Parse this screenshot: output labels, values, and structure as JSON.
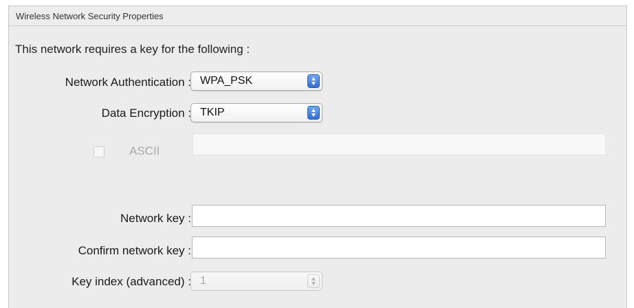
{
  "panel": {
    "title": "Wireless Network Security Properties"
  },
  "intro_text": "This network requires a key for the following :",
  "network_authentication": {
    "label": "Network Authentication :",
    "value": "WPA_PSK"
  },
  "data_encryption": {
    "label": "Data Encryption :",
    "value": "TKIP"
  },
  "ascii": {
    "label": "ASCII",
    "checked": false,
    "enabled": false,
    "field_value": ""
  },
  "network_key": {
    "label": "Network key :",
    "value": ""
  },
  "confirm_network_key": {
    "label": "Confirm network key :",
    "value": ""
  },
  "key_index": {
    "label": "Key index (advanced) :",
    "value": "1",
    "enabled": false
  },
  "icons": {
    "popup_stepper": "up-down-arrows-icon"
  },
  "colors": {
    "stepper_blue": "#2e6fd8",
    "panel_bg": "#ececec"
  }
}
